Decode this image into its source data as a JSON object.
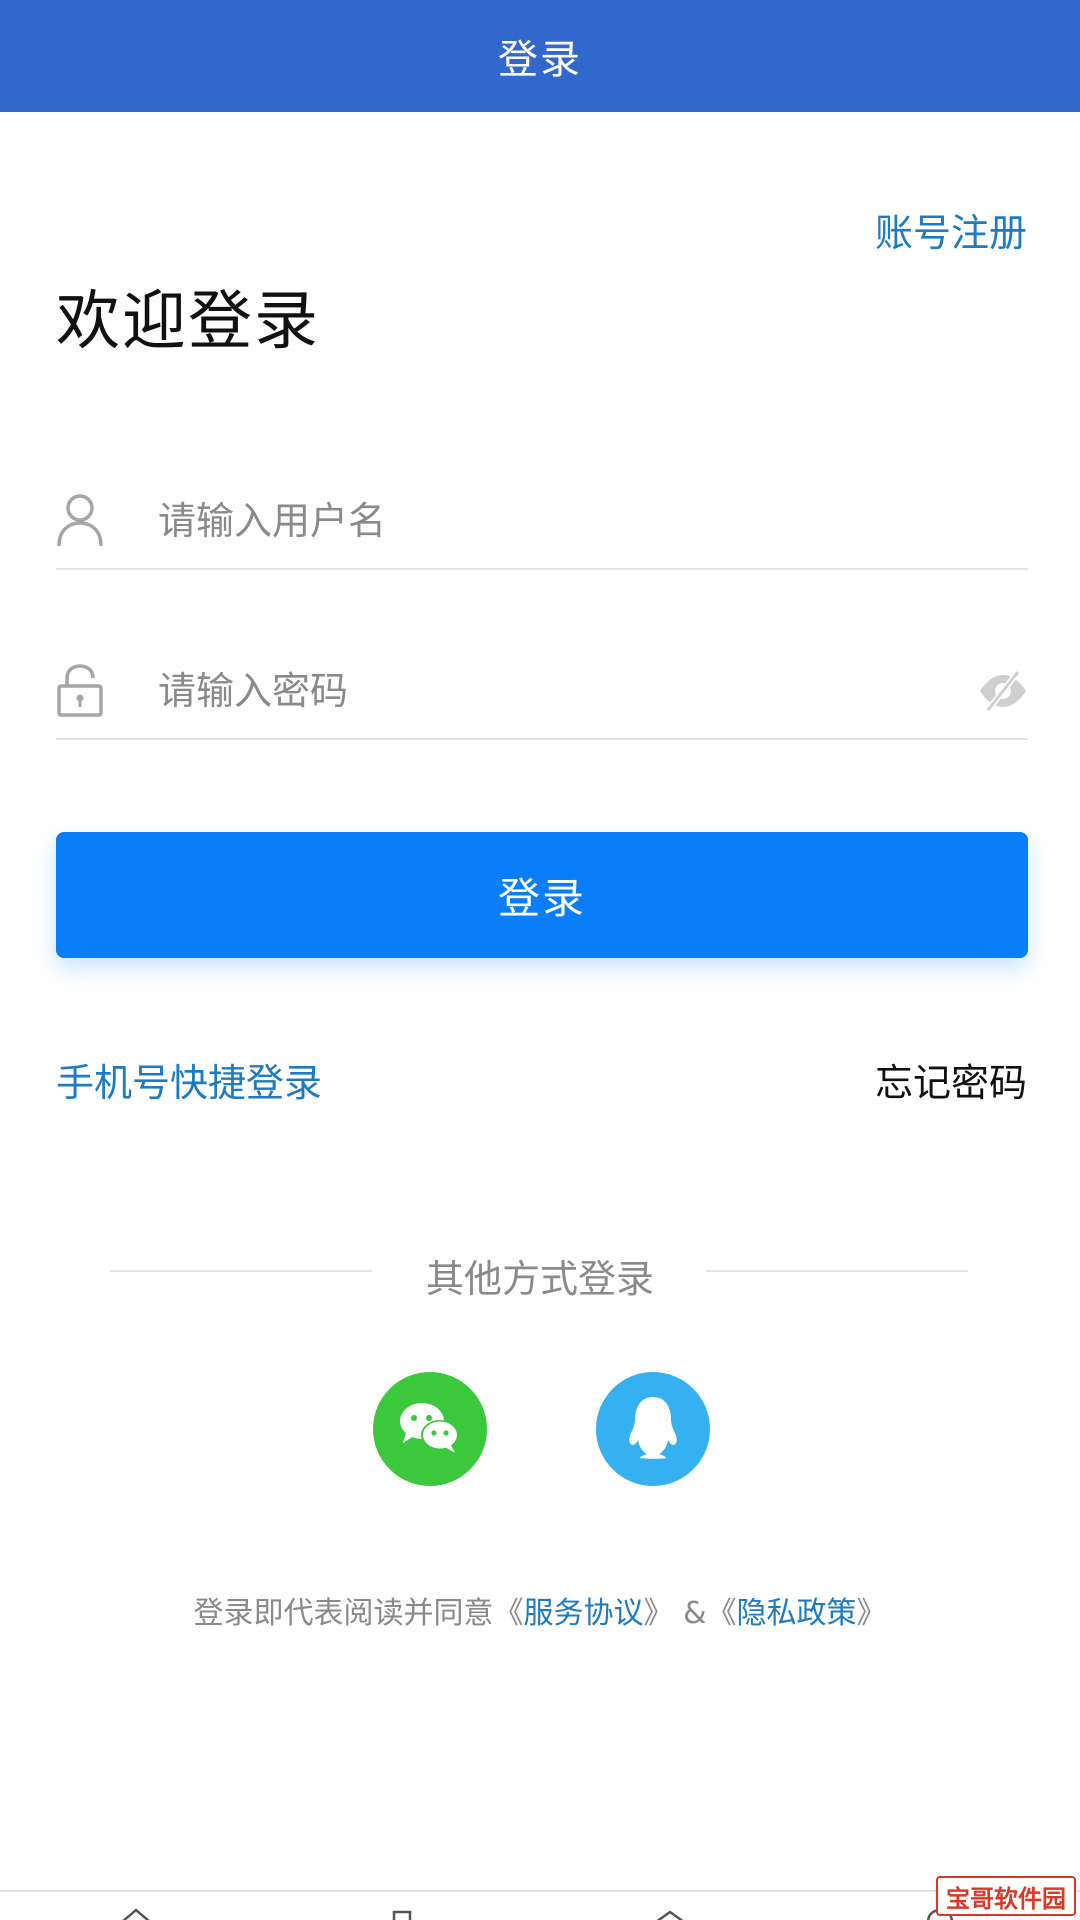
{
  "header": {
    "title": "登录"
  },
  "register_label": "账号注册",
  "welcome_text": "欢迎登录",
  "username": {
    "placeholder": "请输入用户名",
    "value": ""
  },
  "password": {
    "placeholder": "请输入密码",
    "value": ""
  },
  "login_button_label": "登录",
  "quick_login_label": "手机号快捷登录",
  "forgot_label": "忘记密码",
  "other_methods_label": "其他方式登录",
  "social": {
    "wechat_icon": "wechat-icon",
    "qq_icon": "qq-icon"
  },
  "agreement": {
    "prefix": "登录即代表阅读并同意",
    "service_open": "《",
    "service_link": "服务协议",
    "service_close": "》",
    "joiner": " &",
    "privacy_open": "《",
    "privacy_link": "隐私政策",
    "privacy_close": "》"
  },
  "watermark": "宝哥软件园",
  "colors": {
    "header_bg": "#3267cc",
    "primary_button": "#0a7df8",
    "link": "#1f7bc1",
    "wechat": "#3cc83d",
    "qq": "#35b1f2"
  }
}
